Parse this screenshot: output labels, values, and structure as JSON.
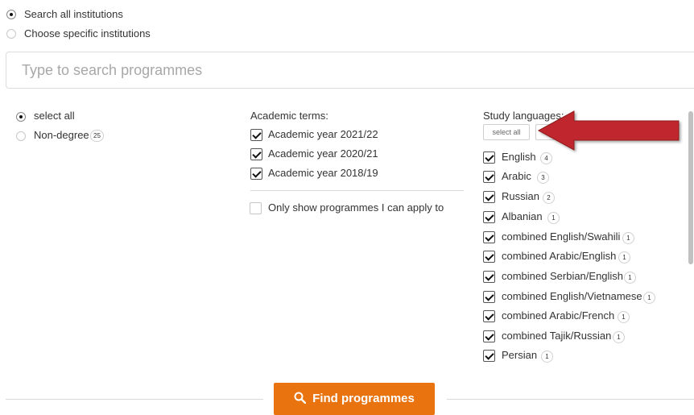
{
  "scope": {
    "options": [
      {
        "label": "Search all institutions",
        "checked": true
      },
      {
        "label": "Choose specific institutions",
        "checked": false
      }
    ]
  },
  "search": {
    "placeholder": "Type to search programmes"
  },
  "degree": {
    "options": [
      {
        "label": "select all",
        "checked": true
      },
      {
        "label": "Non-degree",
        "count": "25",
        "checked": false
      }
    ]
  },
  "terms": {
    "title": "Academic terms:",
    "items": [
      {
        "label": "Academic year 2021/22",
        "checked": true
      },
      {
        "label": "Academic year 2020/21",
        "checked": true
      },
      {
        "label": "Academic year 2018/19",
        "checked": true
      }
    ],
    "apply_only_label": "Only show programmes I can apply to"
  },
  "languages": {
    "title": "Study languages:",
    "select_all_label": "select all",
    "items": [
      {
        "label": "English",
        "count": "4"
      },
      {
        "label": "Arabic",
        "count": "3"
      },
      {
        "label": "Russian",
        "count": "2"
      },
      {
        "label": "Albanian",
        "count": "1"
      },
      {
        "label": "combined English/Swahili",
        "count": "1"
      },
      {
        "label": "combined Arabic/English",
        "count": "1"
      },
      {
        "label": "combined Serbian/English",
        "count": "1"
      },
      {
        "label": "combined English/Vietnamese",
        "count": "1"
      },
      {
        "label": "combined Arabic/French",
        "count": "1"
      },
      {
        "label": "combined Tajik/Russian",
        "count": "1"
      },
      {
        "label": "Persian",
        "count": "1"
      }
    ]
  },
  "actions": {
    "find_label": "Find programmes"
  },
  "colors": {
    "accent": "#e9730f",
    "arrow": "#c0282d"
  },
  "icons": {
    "find": "search-icon",
    "annotation": "arrow-left-icon"
  }
}
